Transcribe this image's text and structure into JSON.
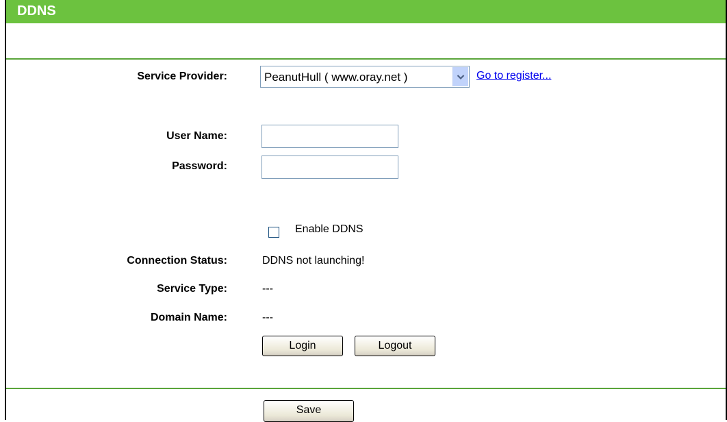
{
  "page": {
    "title": "DDNS"
  },
  "form": {
    "service_provider_label": "Service Provider:",
    "service_provider_value": "PeanutHull ( www.oray.net )",
    "register_link": "Go to register...",
    "username_label": "User Name:",
    "username_value": "",
    "password_label": "Password:",
    "password_value": "",
    "enable_label": "Enable DDNS",
    "enable_checked": false,
    "connection_status_label": "Connection Status:",
    "connection_status_value": "DDNS not launching!",
    "service_type_label": "Service Type:",
    "service_type_value": "---",
    "domain_name_label": "Domain Name:",
    "domain_name_value": "---"
  },
  "buttons": {
    "login": "Login",
    "logout": "Logout",
    "save": "Save"
  },
  "colors": {
    "header_bg": "#6cc23f",
    "divider": "#5aa53a",
    "link": "#0000ee"
  },
  "icons": {
    "select_arrow": "chevron-down-icon"
  }
}
